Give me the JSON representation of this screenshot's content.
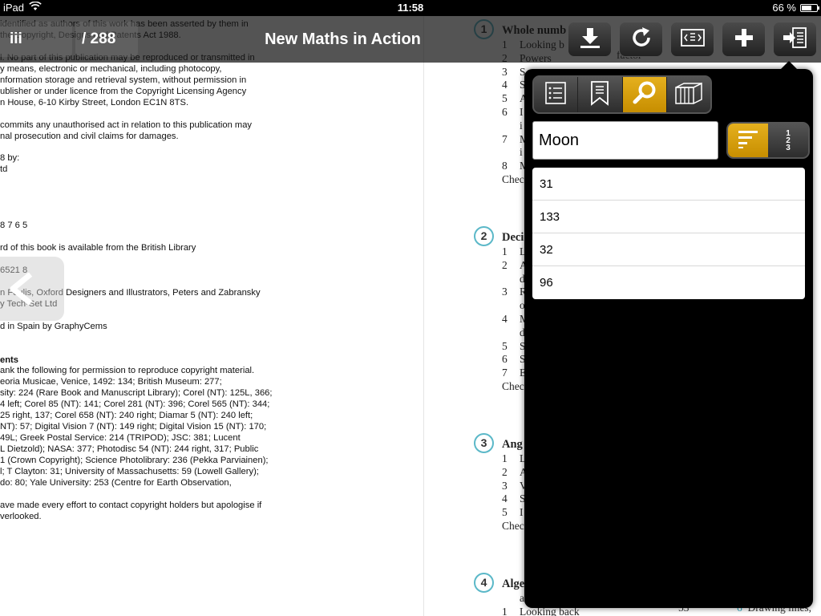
{
  "status": {
    "device": "iPad",
    "time": "11:58",
    "battery": "66 %",
    "battery_level": 0.66
  },
  "toolbar": {
    "current_page": "iii",
    "total_pages": "/ 288",
    "title": "New Maths in Action",
    "buttons": [
      "download-icon",
      "refresh-icon",
      "page-layout-icon",
      "add-icon",
      "exit-icon"
    ]
  },
  "left_page": {
    "lines": [
      "identified as authors of this work has been asserted by them in",
      "the Copyright, Designs and Patents Act 1988.",
      "",
      "l. No part of this publication may be reproduced or transmitted in",
      "y means, electronic or mechanical, including photocopy,",
      "nformation storage and retrieval system, without permission in",
      "ublisher or under licence from the Copyright Licensing Agency",
      "n House, 6-10 Kirby Street, London EC1N 8TS.",
      "",
      "commits any unauthorised act in relation to this publication may",
      "nal prosecution and civil claims for damages.",
      "",
      "8 by:",
      "td",
      "",
      "",
      "",
      "",
      "8 7 6 5",
      "",
      "rd of this book is available from the British Library",
      "",
      "6521 8",
      "",
      "n Foulis, Oxford Designers and Illustrators, Peters and Zabransky",
      "y Tech-Set Ltd",
      "",
      "d in Spain by GraphyCems",
      "",
      "",
      "ents",
      "ank the following for permission to reproduce copyright material.",
      "eoria Musicae, Venice, 1492: 134; British Museum: 277;",
      "sity: 224 (Rare Book and Manuscript Library); Corel (NT): 125L, 366;",
      "4 left; Corel 85 (NT): 141; Corel 281 (NT): 396; Corel 565 (NT): 344;",
      "25 right, 137; Corel 658 (NT): 240 right; Diamar 5 (NT): 240 left;",
      "NT): 57; Digital Vision 7 (NT): 149 right; Digital Vision 15 (NT): 170;",
      "49L; Greek Postal Service: 214 (TRIPOD); JSC: 381; Lucent",
      "L Dietzold); NASA: 377; Photodisc 54 (NT): 244 right, 317; Public",
      "1 (Crown Copyright); Science Photolibrary: 236 (Pekka Parviainen);",
      "l; T Clayton: 31; University of Massachusetts: 59 (Lowell Gallery);",
      "do: 80; Yale University: 253 (Centre for Earth Observation,",
      "",
      "ave made every effort to contact copyright holders but apologise if",
      "verlooked."
    ]
  },
  "right_page": {
    "chapters": [
      {
        "number": "1",
        "title": "Whole numb",
        "items": [
          {
            "n": "1",
            "t": "Looking b"
          },
          {
            "n": "2",
            "t": "Powers"
          },
          {
            "n": "3",
            "t": "S"
          },
          {
            "n": "4",
            "t": "S"
          },
          {
            "n": "5",
            "t": "A"
          },
          {
            "n": "6",
            "t": "I"
          },
          {
            "n": "",
            "t": "i"
          },
          {
            "n": "7",
            "t": "M"
          },
          {
            "n": "",
            "t": "i"
          },
          {
            "n": "8",
            "t": "M"
          },
          {
            "n": "",
            "t": "Chec"
          }
        ]
      },
      {
        "number": "2",
        "title": "Deci",
        "items": [
          {
            "n": "1",
            "t": "L"
          },
          {
            "n": "2",
            "t": "A"
          },
          {
            "n": "",
            "t": "d"
          },
          {
            "n": "3",
            "t": "R"
          },
          {
            "n": "",
            "t": "o"
          },
          {
            "n": "4",
            "t": "M"
          },
          {
            "n": "",
            "t": "d"
          },
          {
            "n": "5",
            "t": "S"
          },
          {
            "n": "6",
            "t": "S"
          },
          {
            "n": "7",
            "t": "E"
          },
          {
            "n": "",
            "t": "Chec"
          }
        ]
      },
      {
        "number": "3",
        "title": "Ang",
        "items": [
          {
            "n": "1",
            "t": "L"
          },
          {
            "n": "2",
            "t": "A"
          },
          {
            "n": "3",
            "t": "V"
          },
          {
            "n": "4",
            "t": "S"
          },
          {
            "n": "5",
            "t": "I"
          },
          {
            "n": "",
            "t": "Chec"
          }
        ]
      },
      {
        "number": "4",
        "title": "Alge",
        "items": [
          {
            "n": "",
            "t": "a"
          },
          {
            "n": "1",
            "t": "Looking back"
          }
        ]
      }
    ],
    "ref_page": "53",
    "ref_item": {
      "n": "6",
      "t": "Drawing lines,"
    },
    "factor_word": "factor"
  },
  "popover": {
    "tabs": [
      "list-icon",
      "bookmarks-icon",
      "search-icon",
      "book-icon"
    ],
    "active_tab": "search-icon",
    "search_value": "Moon",
    "sort_numeric_label": "1\n2\n3",
    "results": [
      "31",
      "133",
      "32",
      "96"
    ]
  }
}
